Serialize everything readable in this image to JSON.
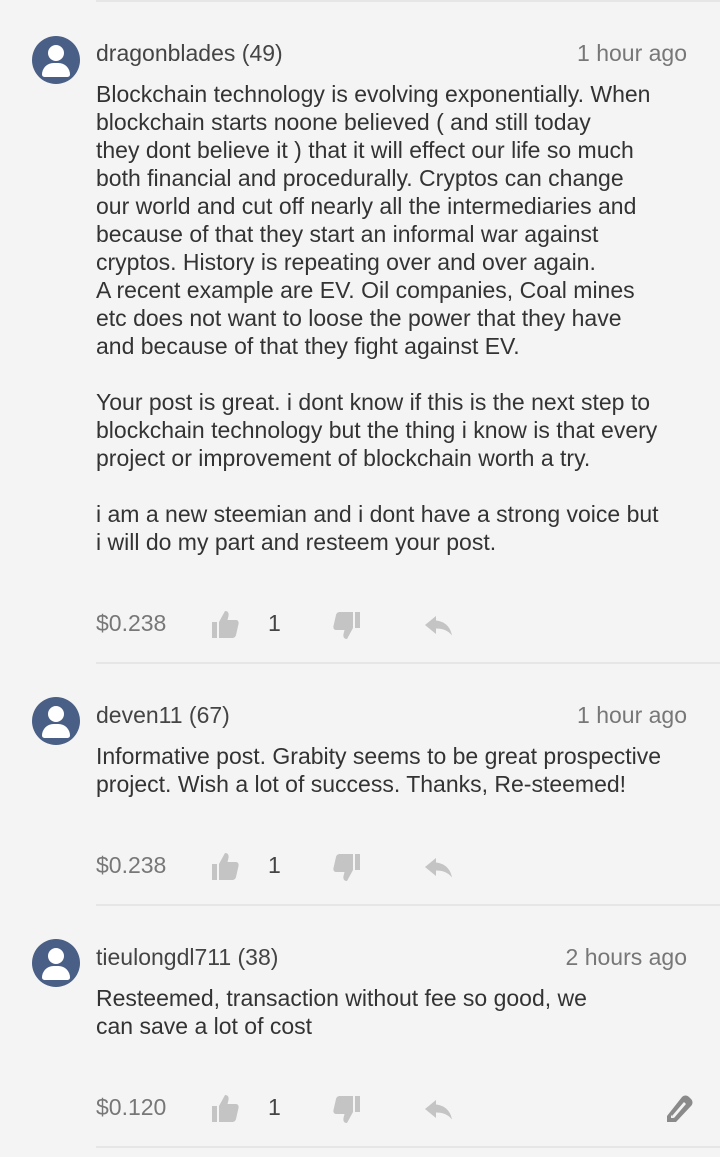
{
  "comments": [
    {
      "author": "dragonblades (49)",
      "time": "1 hour ago",
      "body": "Blockchain technology is evolving exponentially. When\nblockchain starts noone believed ( and still today\nthey dont believe it ) that it will effect our life so much\nboth financial and procedurally. Cryptos can change\nour world and cut off nearly all the intermediaries and\nbecause of that they start an informal war against\ncryptos. History is repeating over and over again.\nA recent example are EV. Oil companies, Coal mines\netc does not want to loose the power that they have\nand because of that they fight against EV.\n\nYour post is great. i dont know if this is the next step to\nblockchain technology but the thing i know is that every\nproject or improvement of blockchain worth a try.\n\ni am a new steemian and i dont have a strong voice but\ni will do my part and resteem your post.",
      "payout": "$0.238",
      "votes": "1"
    },
    {
      "author": "deven11 (67)",
      "time": "1 hour ago",
      "body": "Informative post. Grabity seems to be great prospective\nproject. Wish a lot of success. Thanks, Re-steemed!",
      "payout": "$0.238",
      "votes": "1"
    },
    {
      "author": "tieulongdl711 (38)",
      "time": "2 hours ago",
      "body": "Resteemed, transaction without fee so good, we\ncan save a lot of cost",
      "payout": "$0.120",
      "votes": "1"
    }
  ],
  "icons": {
    "avatar": "user-avatar-icon",
    "upvote": "thumbs-up-icon",
    "downvote": "thumbs-down-icon",
    "reply": "reply-arrow-icon",
    "edit": "edit-pen-icon"
  },
  "colors": {
    "background": "#f4f4f4",
    "avatar": "#4a5f85",
    "icon": "#c4c4c4",
    "muted_text": "#777777"
  }
}
